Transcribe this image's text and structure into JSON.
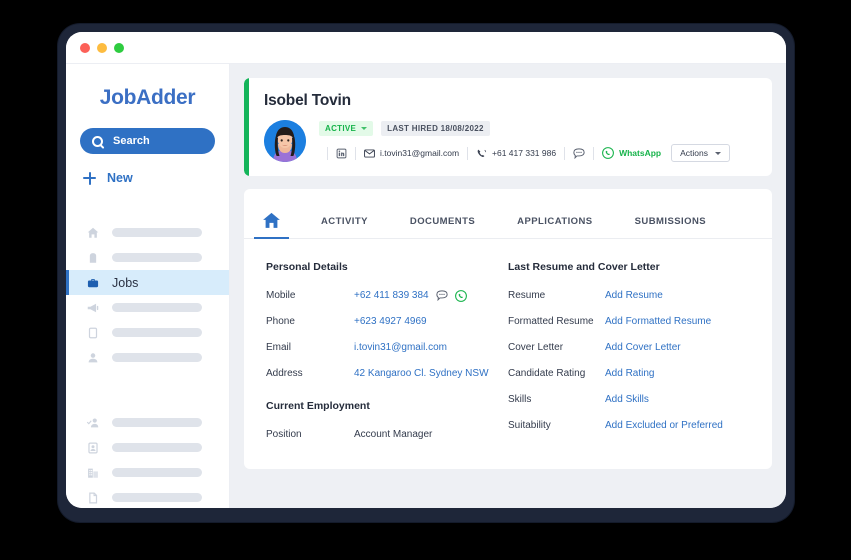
{
  "window": {
    "traffic_lights": [
      "close",
      "minimize",
      "maximize"
    ]
  },
  "sidebar": {
    "brand": "JobAdder",
    "search_label": "Search",
    "search_icon": "search-icon",
    "new_label": "New",
    "new_icon": "plus-icon",
    "group_one": [
      {
        "icon": "home-icon",
        "label": ""
      },
      {
        "icon": "bag-icon",
        "label": ""
      },
      {
        "icon": "briefcase-icon",
        "label": "Jobs",
        "active": true
      },
      {
        "icon": "megaphone-icon",
        "label": ""
      },
      {
        "icon": "note-icon",
        "label": ""
      },
      {
        "icon": "person-icon",
        "label": ""
      }
    ],
    "group_two": [
      {
        "icon": "person-check-icon",
        "label": ""
      },
      {
        "icon": "contact-card-icon",
        "label": ""
      },
      {
        "icon": "building-icon",
        "label": ""
      },
      {
        "icon": "document-icon",
        "label": ""
      }
    ]
  },
  "profile": {
    "name": "Isobel Tovin",
    "avatar": "candidate-photo",
    "status_badge": "ACTIVE",
    "last_hired_badge": "LAST HIRED 18/08/2022",
    "contacts": {
      "linkedin_icon": "linkedin-icon",
      "email_icon": "envelope-icon",
      "email": "i.tovin31@gmail.com",
      "phone_icon": "phone-icon",
      "phone": "+61 417 331 986",
      "sms_icon": "sms-icon",
      "whatsapp_icon": "whatsapp-icon",
      "whatsapp_label": "WhatsApp"
    },
    "actions_label": "Actions"
  },
  "tabs": [
    {
      "label": "",
      "icon": "home-icon",
      "active": true
    },
    {
      "label": "ACTIVITY",
      "active": false
    },
    {
      "label": "DOCUMENTS",
      "active": false
    },
    {
      "label": "APPLICATIONS",
      "active": false
    },
    {
      "label": "SUBMISSIONS",
      "active": false
    }
  ],
  "personal_details": {
    "title": "Personal Details",
    "rows": [
      {
        "key": "Mobile",
        "value": "+62 411 839 384",
        "icons": [
          "sms-icon",
          "whatsapp-icon"
        ]
      },
      {
        "key": "Phone",
        "value": "+623 4927 4969"
      },
      {
        "key": "Email",
        "value": "i.tovin31@gmail.com"
      },
      {
        "key": "Address",
        "value": "42 Kangaroo Cl. Sydney NSW"
      }
    ]
  },
  "current_employment": {
    "title": "Current Employment",
    "rows": [
      {
        "key": "Position",
        "value": "Account Manager"
      }
    ]
  },
  "resume_section": {
    "title": "Last Resume and Cover Letter",
    "rows": [
      {
        "key": "Resume",
        "value": "Add Resume"
      },
      {
        "key": "Formatted Resume",
        "value": "Add Formatted Resume"
      },
      {
        "key": "Cover Letter",
        "value": "Add Cover Letter"
      },
      {
        "key": "Candidate Rating",
        "value": "Add Rating"
      },
      {
        "key": "Skills",
        "value": "Add Skills"
      },
      {
        "key": "Suitability",
        "value": "Add Excluded or Preferred"
      }
    ]
  },
  "colors": {
    "brand_blue": "#2f71c4",
    "accent_green": "#14b45a",
    "frame_navy": "#1e2639",
    "content_bg": "#eef0f4",
    "active_nav_bg": "#d7ecfb"
  }
}
